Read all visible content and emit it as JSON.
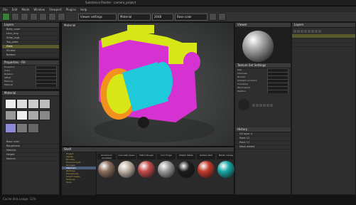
{
  "window": {
    "title": "Substance Painter - camera_project"
  },
  "menu": [
    "File",
    "Edit",
    "Mode",
    "Window",
    "Viewport",
    "Plugins",
    "Help"
  ],
  "toolbar": {
    "shader": "Viewer settings",
    "channel": "Material",
    "resolution": "2048",
    "layer": "Base color"
  },
  "layers_panel": {
    "title": "Layers",
    "rows": [
      "Body_color",
      "Lens_ring",
      "Strap_lugs",
      "Top_plate",
      "Dials",
      "Shutter",
      "Bottom"
    ],
    "selected_index": 4
  },
  "properties_panel": {
    "title": "Properties - Fill",
    "rows": [
      "Projection",
      "Scale",
      "Rotation",
      "Offset",
      "Filtering",
      "Material"
    ]
  },
  "swatches_panel": {
    "title": "Material",
    "rows": [
      "Base color",
      "Roughness",
      "Metallic",
      "Height",
      "Normal"
    ]
  },
  "viewport": {
    "label": "Material",
    "colors": {
      "body": "#d632d2",
      "lens": "#1ec9d9",
      "plates": "#d6e616",
      "orange": "#f2911c"
    }
  },
  "shelf": {
    "title": "Shelf",
    "folders": [
      "Project",
      "Alphas",
      "Brushes",
      "Environments",
      "Grunges",
      "Materials",
      "Particles",
      "Procedurals",
      "Smart masks",
      "Textures",
      "Tools"
    ],
    "selected_folder": 5,
    "materials": [
      {
        "name": "Aluminium Anodized",
        "color": "#8a6e5e"
      },
      {
        "name": "Concrete Clean",
        "color": "#bfb2a5"
      },
      {
        "name": "Fabric Rough",
        "color": "#c24a4a"
      },
      {
        "name": "Iron Forge",
        "color": "#9a9a9a"
      },
      {
        "name": "Plastic Matte",
        "color": "#1c1c1c"
      },
      {
        "name": "Rubber Red",
        "color": "#c23a2a"
      },
      {
        "name": "Plastic Glossy",
        "color": "#19a6a6"
      },
      {
        "name": "Cloth Red",
        "color": "#c22a3a"
      }
    ]
  },
  "texture_set": {
    "title": "Texture Set Settings",
    "rows": [
      "Size",
      "Channels",
      "Normal",
      "Ambient occlusion",
      "Curvature",
      "World space",
      "Position"
    ]
  },
  "history": {
    "title": "History",
    "rows": [
      "Fill layer 4",
      "Paint 12",
      "Paint 11",
      "Mask added"
    ]
  },
  "status": {
    "text": "Cache disk usage: 12%"
  }
}
